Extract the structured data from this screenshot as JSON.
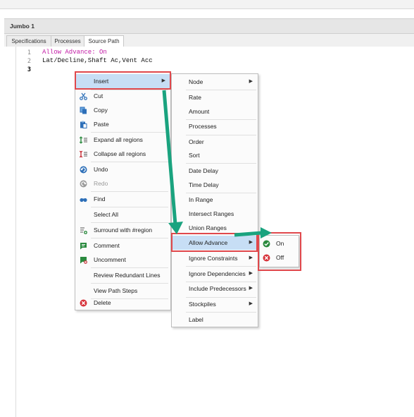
{
  "window": {
    "title": "Jumbo 1"
  },
  "tabs": [
    {
      "label": "Specifications"
    },
    {
      "label": "Processes"
    },
    {
      "label": "Source Path"
    }
  ],
  "editor": {
    "lines": [
      {
        "num": "1",
        "text": "Allow Advance: On"
      },
      {
        "num": "2",
        "text": "Lat/Decline,Shaft Ac,Vent Acc"
      },
      {
        "num": "3",
        "text": ""
      }
    ]
  },
  "context_menu": {
    "items": [
      {
        "label": "Insert",
        "icon": "none",
        "submenu": true
      },
      {
        "label": "Cut",
        "icon": "scissors-icon"
      },
      {
        "label": "Copy",
        "icon": "copy-icon"
      },
      {
        "label": "Paste",
        "icon": "paste-icon"
      },
      {
        "label": "Expand all regions",
        "icon": "expand-icon"
      },
      {
        "label": "Collapse all regions",
        "icon": "collapse-icon"
      },
      {
        "label": "Undo",
        "icon": "undo-icon"
      },
      {
        "label": "Redo",
        "icon": "redo-icon",
        "disabled": true
      },
      {
        "label": "Find",
        "icon": "binoculars-icon"
      },
      {
        "label": "Select All",
        "icon": "none"
      },
      {
        "label": "Surround with #region",
        "icon": "surround-icon"
      },
      {
        "label": "Comment",
        "icon": "comment-icon"
      },
      {
        "label": "Uncomment",
        "icon": "uncomment-icon"
      },
      {
        "label": "Review Redundant Lines",
        "icon": "none"
      },
      {
        "label": "View Path Steps",
        "icon": "none"
      },
      {
        "label": "Delete",
        "icon": "delete-icon"
      }
    ]
  },
  "insert_submenu": {
    "items": [
      {
        "label": "Node",
        "submenu": true
      },
      {
        "label": "Rate"
      },
      {
        "label": "Amount"
      },
      {
        "label": "Processes"
      },
      {
        "label": "Order"
      },
      {
        "label": "Sort"
      },
      {
        "label": "Date Delay"
      },
      {
        "label": "Time Delay"
      },
      {
        "label": "In Range"
      },
      {
        "label": "Intersect Ranges"
      },
      {
        "label": "Union Ranges"
      },
      {
        "label": "Allow Advance",
        "submenu": true
      },
      {
        "label": "Ignore Constraints",
        "submenu": true
      },
      {
        "label": "Ignore Dependencies",
        "submenu": true
      },
      {
        "label": "Include Predecessors",
        "submenu": true
      },
      {
        "label": "Stockpiles",
        "submenu": true
      },
      {
        "label": "Label"
      }
    ]
  },
  "allow_advance_submenu": {
    "items": [
      {
        "label": "On",
        "icon": "check-icon"
      },
      {
        "label": "Off",
        "icon": "cross-icon"
      }
    ]
  },
  "colors": {
    "highlight": "#c7def5",
    "annotation_red": "#e0484c",
    "annotation_arrow": "#1aa37f",
    "keyword": "#c21aa5"
  }
}
